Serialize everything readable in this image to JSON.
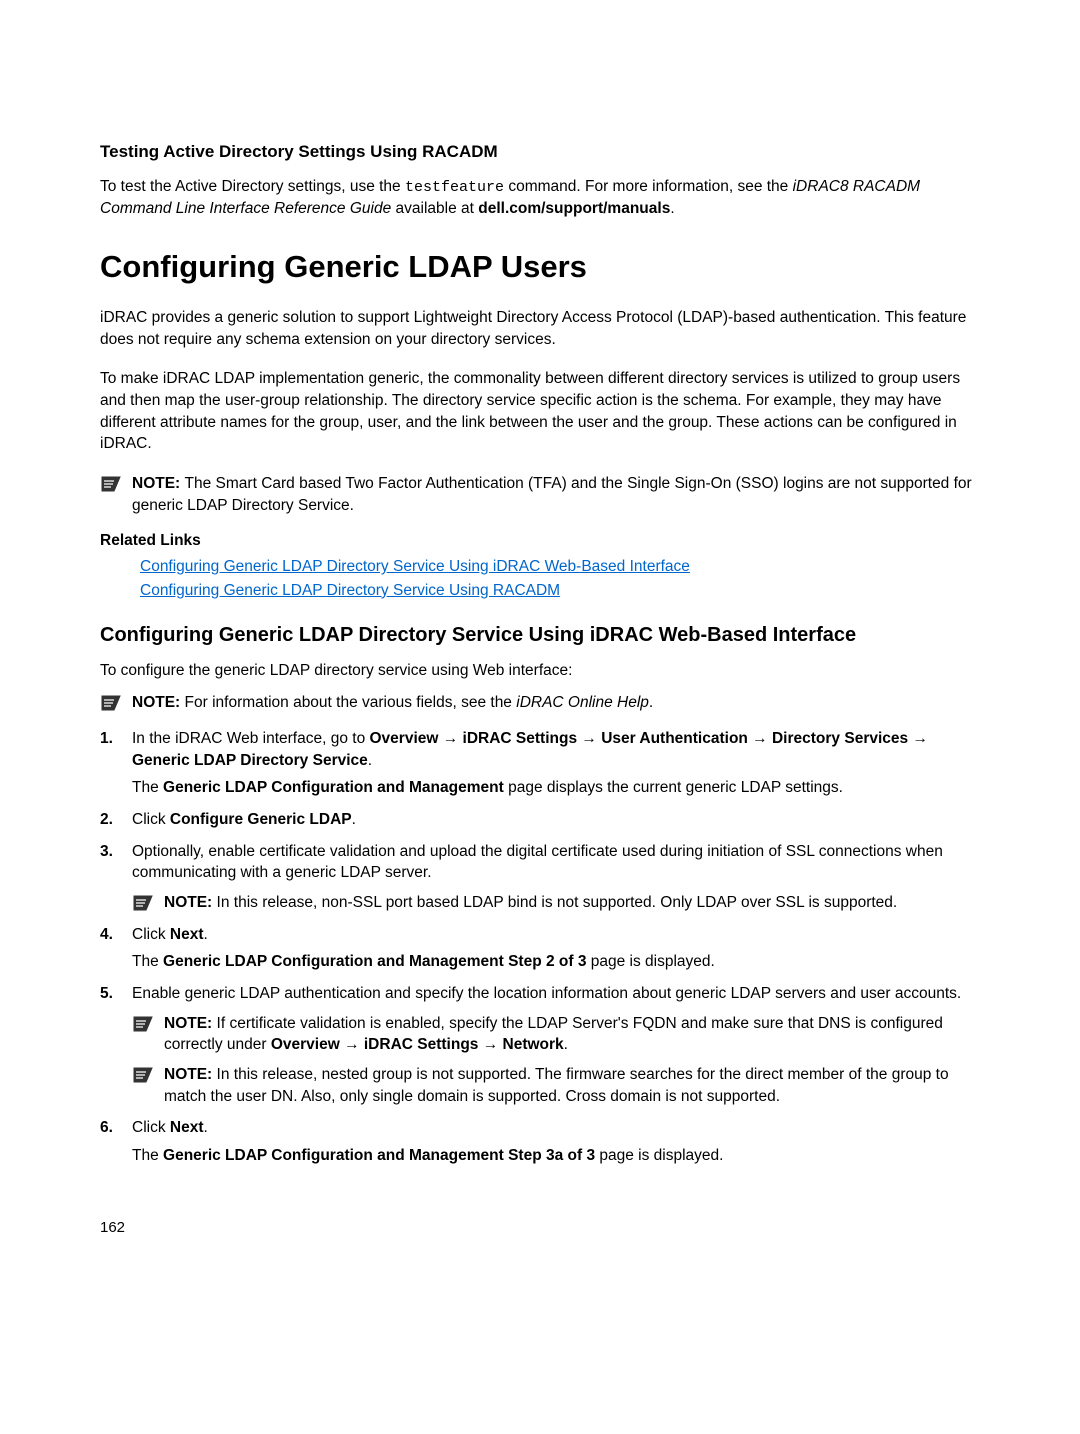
{
  "section1": {
    "heading": "Testing Active Directory Settings Using RACADM",
    "para_pre": "To test the Active Directory settings, use the ",
    "para_code": "testfeature",
    "para_mid": " command. For more information, see the ",
    "para_italic": "iDRAC8 RACADM Command Line Interface Reference Guide",
    "para_post": " available at ",
    "para_bold": "dell.com/support/manuals",
    "para_end": "."
  },
  "main_title": "Configuring Generic LDAP Users",
  "intro": {
    "para1": "iDRAC provides a generic solution to support Lightweight Directory Access Protocol (LDAP)-based authentication. This feature does not require any schema extension on your directory services.",
    "para2": "To make iDRAC LDAP implementation generic, the commonality between different directory services is utilized to group users and then map the user-group relationship. The directory service specific action is the schema. For example, they may have different attribute names for the group, user, and the link between the user and the group. These actions can be configured in iDRAC."
  },
  "note1": {
    "label": "NOTE: ",
    "text": "The Smart Card based Two Factor Authentication (TFA) and the Single Sign-On (SSO) logins are not supported for generic LDAP Directory Service."
  },
  "related_links": {
    "heading": "Related Links",
    "link1": "Configuring Generic LDAP Directory Service Using iDRAC Web-Based Interface",
    "link2": "Configuring Generic LDAP Directory Service Using RACADM"
  },
  "subheading": "Configuring Generic LDAP Directory Service Using iDRAC Web-Based Interface",
  "subintro": "To configure the generic LDAP directory service using Web interface:",
  "note2": {
    "label": "NOTE: ",
    "pre": "For information about the various fields, see the ",
    "italic": "iDRAC Online Help",
    "post": "."
  },
  "steps": {
    "s1": {
      "pre": "In the iDRAC Web interface, go to ",
      "path": "Overview → iDRAC Settings → User Authentication → Directory Services → Generic LDAP Directory Service",
      "post": ".",
      "sub_pre": "The ",
      "sub_bold": "Generic LDAP Configuration and Management",
      "sub_post": " page displays the current generic LDAP settings."
    },
    "s2": {
      "pre": "Click ",
      "bold": "Configure Generic LDAP",
      "post": "."
    },
    "s3": {
      "text": "Optionally, enable certificate validation and upload the digital certificate used during initiation of SSL connections when communicating with a generic LDAP server.",
      "note_label": "NOTE: ",
      "note_text": "In this release, non-SSL port based LDAP bind is not supported. Only LDAP over SSL is supported."
    },
    "s4": {
      "pre": "Click ",
      "bold": "Next",
      "post": ".",
      "sub_pre": "The ",
      "sub_bold": "Generic LDAP Configuration and Management Step 2 of 3",
      "sub_post": " page is displayed."
    },
    "s5": {
      "text": "Enable generic LDAP authentication and specify the location information about generic LDAP servers and user accounts.",
      "note1_label": "NOTE: ",
      "note1_pre": "If certificate validation is enabled, specify the LDAP Server's FQDN and make sure that DNS is configured correctly under ",
      "note1_bold": "Overview → iDRAC Settings → Network",
      "note1_post": ".",
      "note2_label": "NOTE: ",
      "note2_text": "In this release, nested group is not supported. The firmware searches for the direct member of the group to match the user DN. Also, only single domain is supported. Cross domain is not supported."
    },
    "s6": {
      "pre": "Click ",
      "bold": "Next",
      "post": ".",
      "sub_pre": "The ",
      "sub_bold": "Generic LDAP Configuration and Management Step 3a of 3",
      "sub_post": " page is displayed."
    }
  },
  "page_number": "162"
}
